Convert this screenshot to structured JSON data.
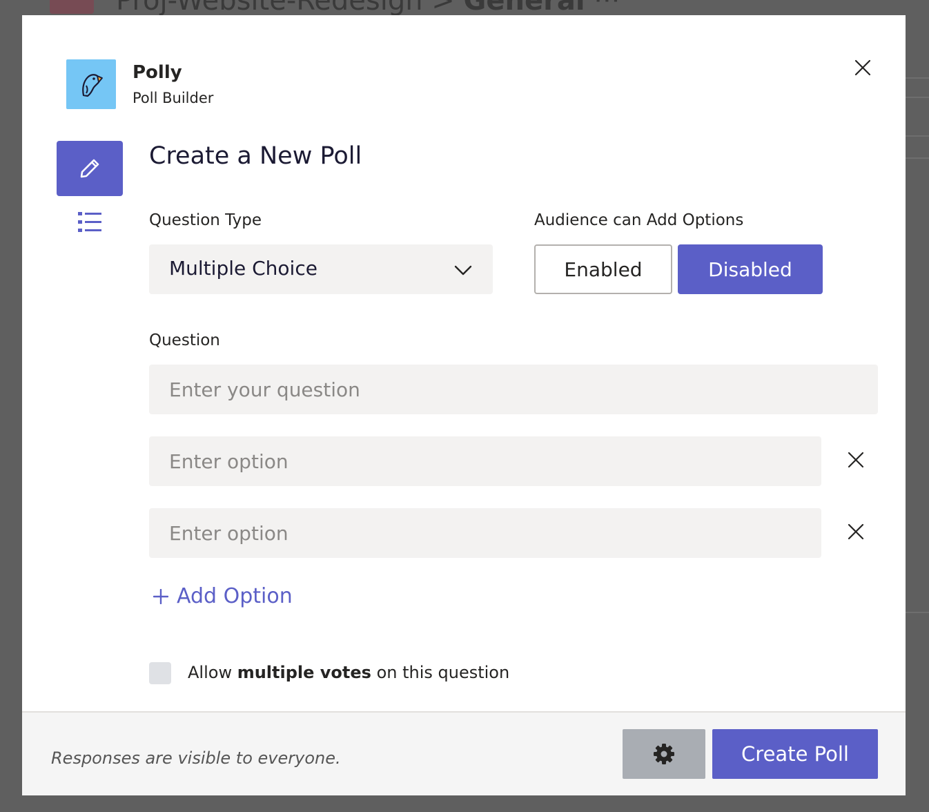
{
  "background": {
    "breadcrumb_channel": "Proj-Website-Redesign",
    "breadcrumb_separator": ">",
    "breadcrumb_current": "General",
    "breadcrumb_more": "···"
  },
  "app": {
    "name": "Polly",
    "subtitle": "Poll Builder",
    "icon": "parrot-logo-icon",
    "accent_color": "#5b5fc7",
    "icon_bg_color": "#75c6f5"
  },
  "nav": {
    "items": [
      {
        "icon": "pencil-icon",
        "active": true
      },
      {
        "icon": "list-icon",
        "active": false
      }
    ]
  },
  "form": {
    "title": "Create a New Poll",
    "question_type_label": "Question Type",
    "question_type_value": "Multiple Choice",
    "audience_label": "Audience can Add Options",
    "audience_options": [
      "Enabled",
      "Disabled"
    ],
    "audience_selected": "Disabled",
    "question_label": "Question",
    "question_placeholder": "Enter your question",
    "option_placeholders": [
      "Enter option",
      "Enter option"
    ],
    "add_option_label": "Add Option",
    "multiple_votes": {
      "prefix": "Allow ",
      "bold": "multiple votes",
      "suffix": " on this question",
      "checked": false
    }
  },
  "footer": {
    "note": "Responses are visible to everyone.",
    "settings_icon": "gear-icon",
    "create_label": "Create Poll"
  }
}
